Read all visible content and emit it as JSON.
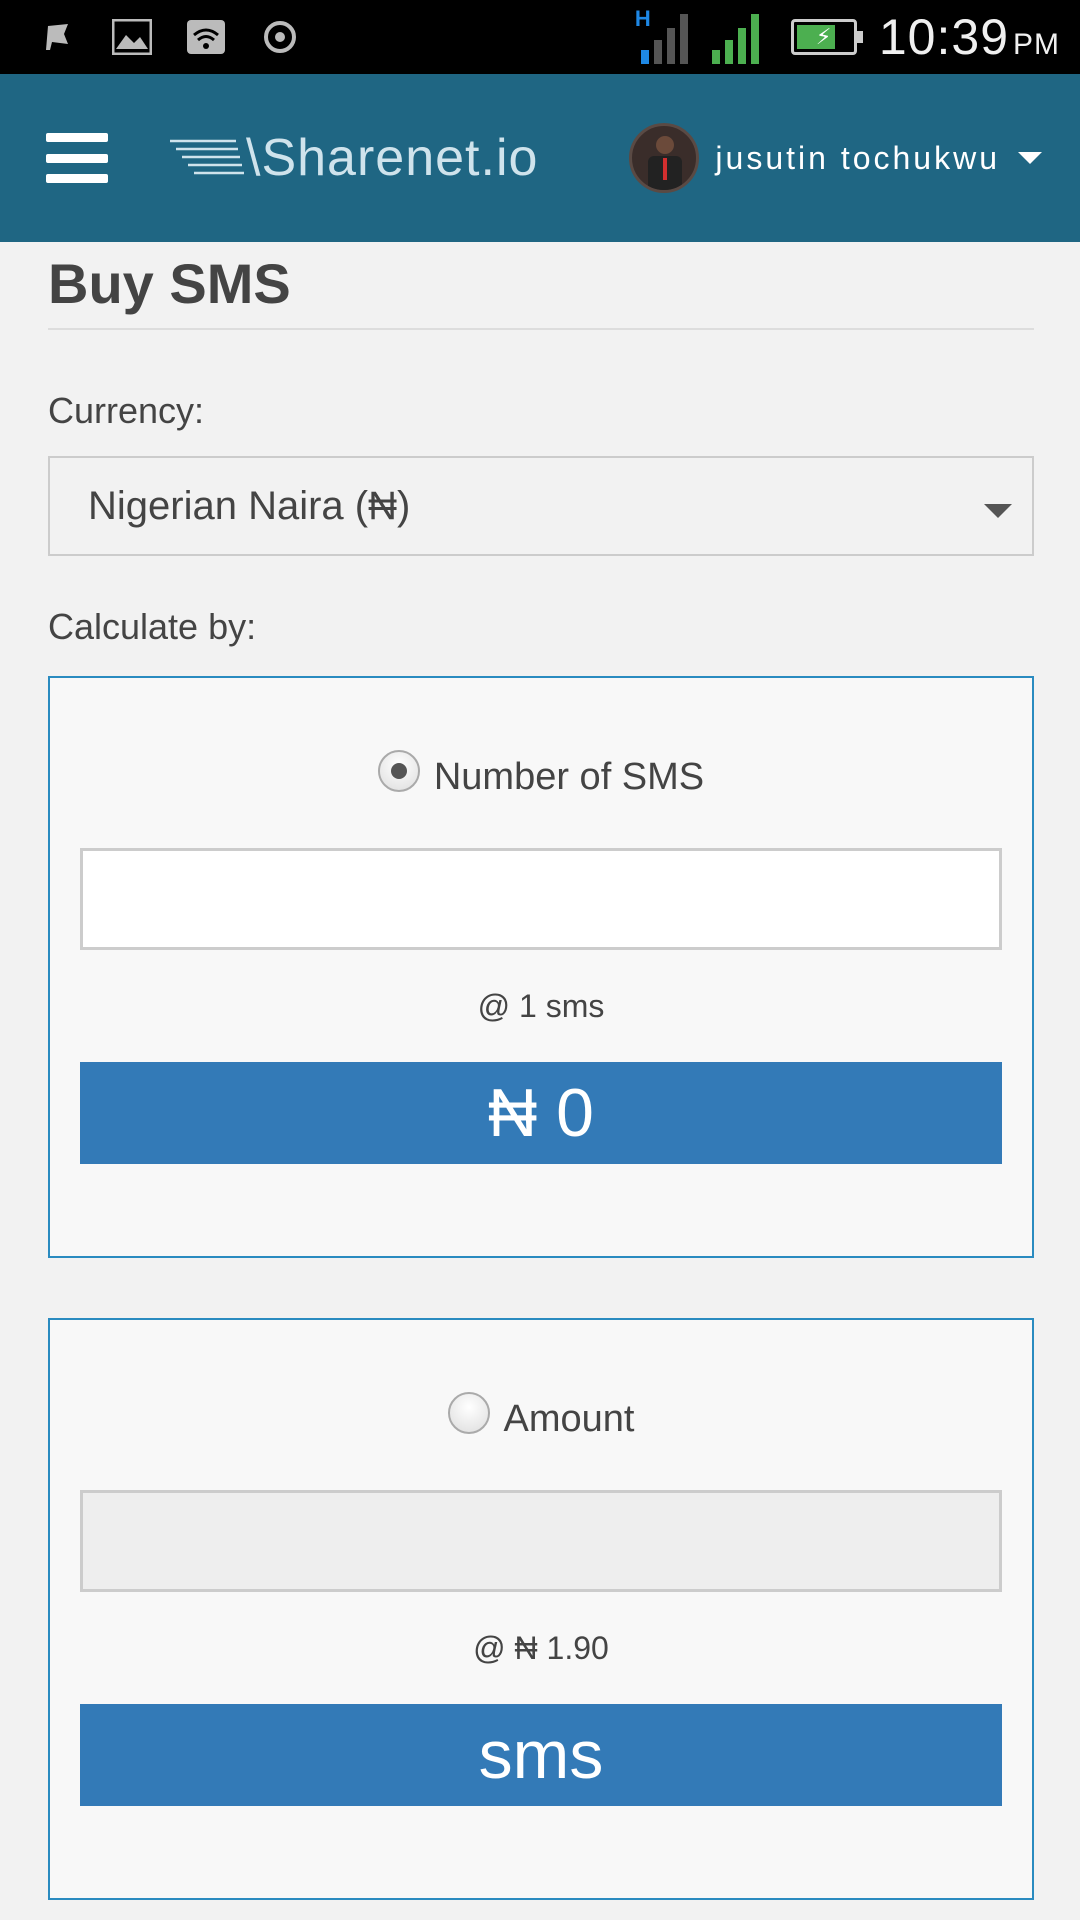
{
  "status_bar": {
    "time": "10:39",
    "ampm": "PM",
    "network_type": "H",
    "icons": [
      "notification-icon",
      "image-icon",
      "wifi-icon",
      "sync-icon"
    ],
    "signal_color": "#4caf50"
  },
  "header": {
    "logo_text": "\\Sharenet.io",
    "user_name": "jusutin tochukwu",
    "bg_color": "#1f6683"
  },
  "page": {
    "title": "Buy SMS",
    "currency_label": "Currency:",
    "currency_value": "Nigerian Naira (₦)",
    "calculate_label": "Calculate by:"
  },
  "by_number": {
    "radio_label": "Number of SMS",
    "selected": true,
    "input_value": "",
    "rate_text": "@ 1 sms",
    "result_text": "₦ 0"
  },
  "by_amount": {
    "radio_label": "Amount",
    "selected": false,
    "input_value": "",
    "rate_text": "@ ₦ 1.90",
    "result_text": "sms"
  },
  "colors": {
    "accent": "#337ab7",
    "box_border": "#2a8bc0"
  }
}
